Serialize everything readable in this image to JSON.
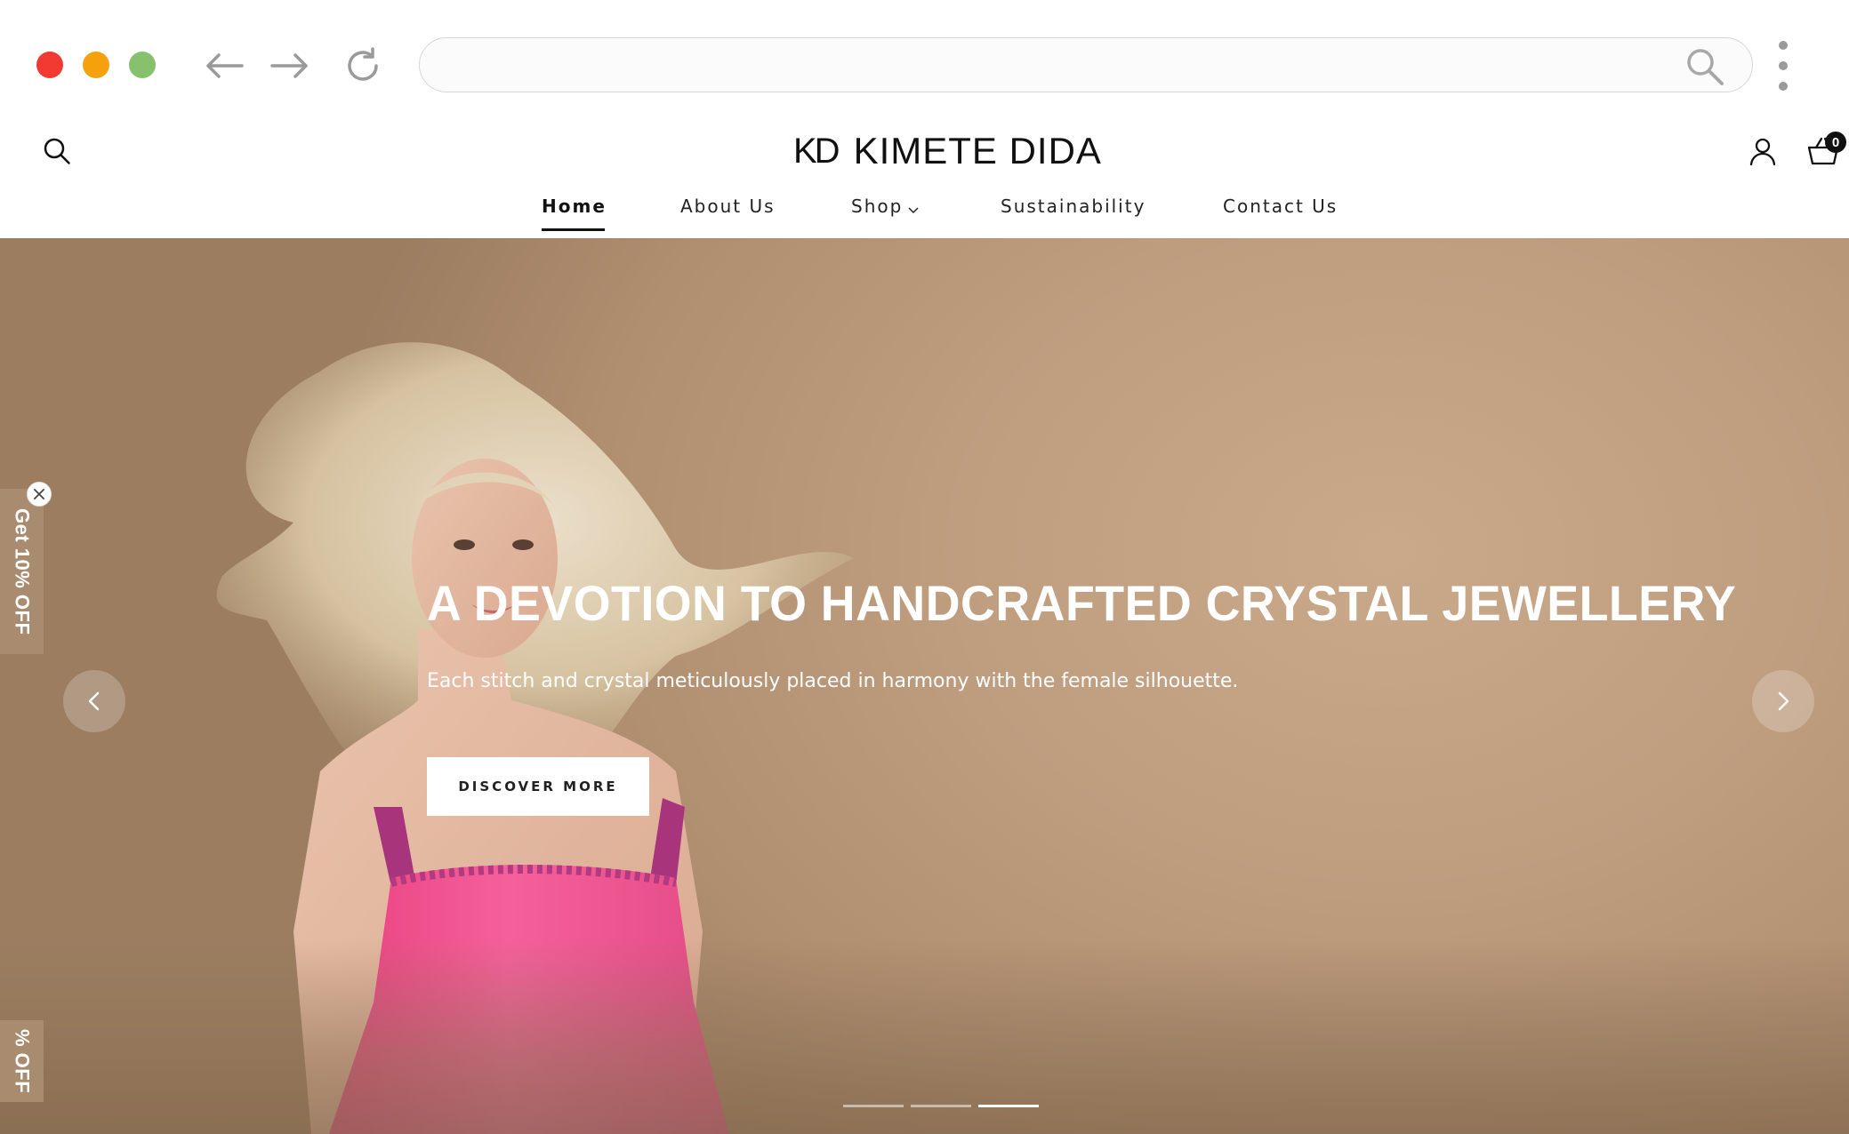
{
  "browser": {
    "url": "",
    "icons": [
      "close-dot",
      "minimize-dot",
      "maximize-dot",
      "back-arrow-icon",
      "forward-arrow-icon",
      "reload-icon",
      "search-icon",
      "kebab-menu-icon"
    ]
  },
  "header": {
    "logo_mark": "KD",
    "brand": "KIMETE DIDA",
    "cart_count": "0"
  },
  "nav": {
    "items": [
      {
        "label": "Home",
        "active": true
      },
      {
        "label": "About Us",
        "active": false
      },
      {
        "label": "Shop",
        "active": false,
        "has_dropdown": true
      },
      {
        "label": "Sustainability",
        "active": false
      },
      {
        "label": "Contact Us",
        "active": false
      }
    ]
  },
  "hero": {
    "title": "A DEVOTION TO HANDCRAFTED CRYSTAL JEWELLERY",
    "subtitle": "Each stitch and crystal meticulously placed in harmony with the female silhouette.",
    "cta_label": "DISCOVER MORE",
    "slide_count": 3,
    "active_slide": 3
  },
  "side_tabs": {
    "top_label": "Get 10% OFF",
    "bottom_label": "% OFF"
  },
  "colors": {
    "hero_bg": "#bf9e80",
    "dress": "#f2528f",
    "tab_bg": "#a98b70"
  }
}
